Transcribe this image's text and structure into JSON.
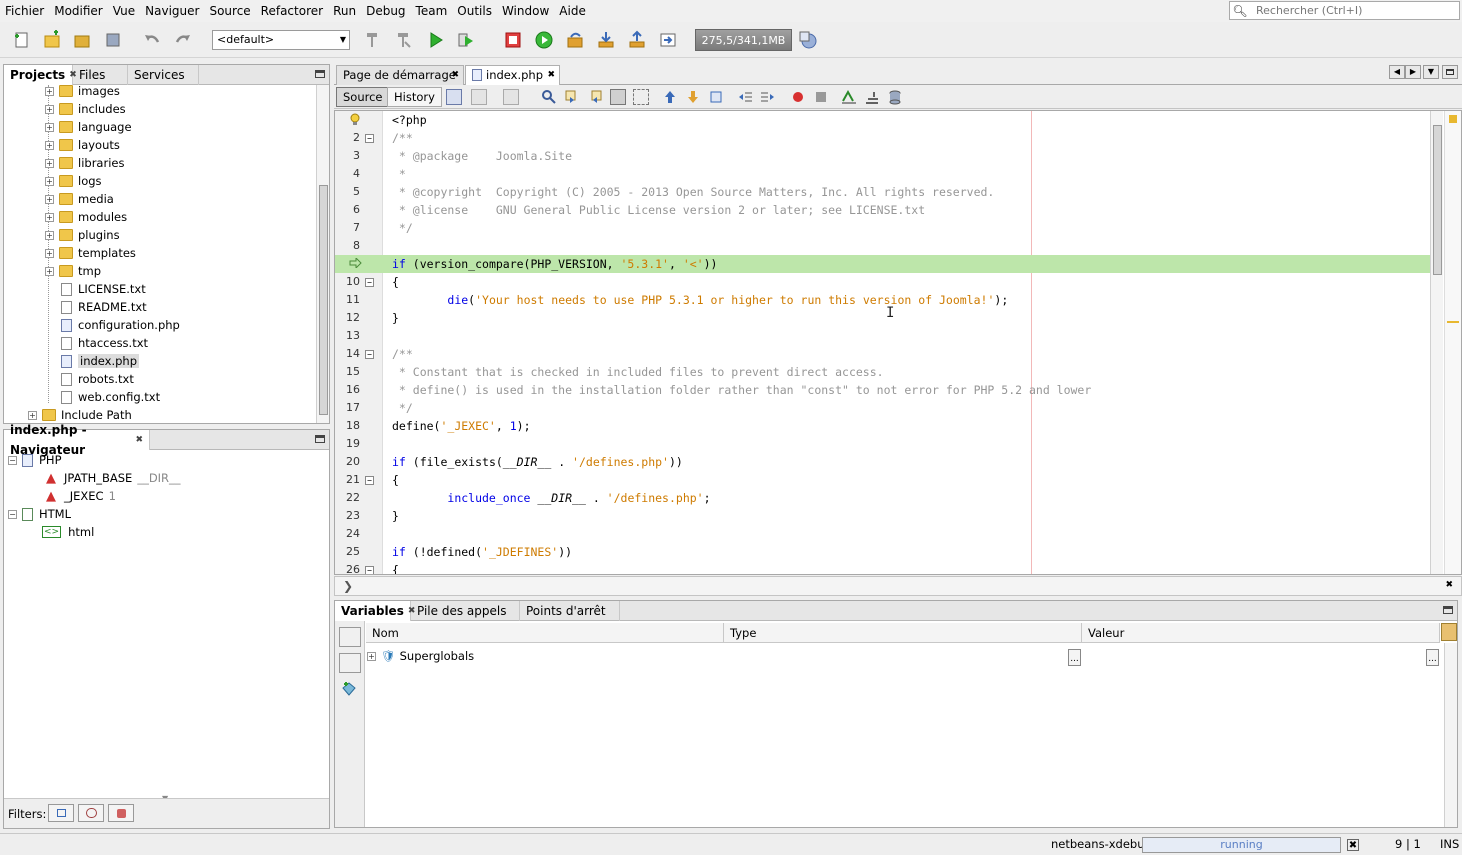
{
  "menubar": {
    "items": [
      "Fichier",
      "Modifier",
      "Vue",
      "Naviguer",
      "Source",
      "Refactorer",
      "Run",
      "Debug",
      "Team",
      "Outils",
      "Window",
      "Aide"
    ],
    "search_placeholder": "Rechercher (Ctrl+I)"
  },
  "toolbar": {
    "config_value": "<default>",
    "memory": "275,5/341,1MB"
  },
  "projects": {
    "tabs": [
      "Projects",
      "Files",
      "Services"
    ],
    "tree": [
      {
        "label": "images",
        "kind": "folder"
      },
      {
        "label": "includes",
        "kind": "folder"
      },
      {
        "label": "language",
        "kind": "folder"
      },
      {
        "label": "layouts",
        "kind": "folder"
      },
      {
        "label": "libraries",
        "kind": "folder"
      },
      {
        "label": "logs",
        "kind": "folder"
      },
      {
        "label": "media",
        "kind": "folder"
      },
      {
        "label": "modules",
        "kind": "folder"
      },
      {
        "label": "plugins",
        "kind": "folder"
      },
      {
        "label": "templates",
        "kind": "folder"
      },
      {
        "label": "tmp",
        "kind": "folder"
      },
      {
        "label": "LICENSE.txt",
        "kind": "file"
      },
      {
        "label": "README.txt",
        "kind": "file"
      },
      {
        "label": "configuration.php",
        "kind": "php"
      },
      {
        "label": "htaccess.txt",
        "kind": "file"
      },
      {
        "label": "index.php",
        "kind": "php"
      },
      {
        "label": "robots.txt",
        "kind": "file"
      },
      {
        "label": "web.config.txt",
        "kind": "file"
      }
    ],
    "include_path": "Include Path"
  },
  "navigator": {
    "title": "index.php - Navigateur",
    "php": "PHP",
    "jpath_base": "JPATH_BASE",
    "jpath_base_val": "__DIR__",
    "jexec": "_JEXEC",
    "jexec_val": "1",
    "html": "HTML",
    "html_child": "html",
    "filters": "Filters:"
  },
  "editor": {
    "tabs": [
      "Page de démarrage",
      "index.php"
    ],
    "source": "Source",
    "history": "History",
    "current_line": 9,
    "lines": [
      {
        "n": "",
        "segs": [
          [
            "t",
            "<?php"
          ]
        ]
      },
      {
        "n": "2",
        "fold": "−",
        "segs": [
          [
            "cm",
            "/**"
          ]
        ]
      },
      {
        "n": "3",
        "segs": [
          [
            "cm",
            " * @package    Joomla.Site"
          ]
        ]
      },
      {
        "n": "4",
        "segs": [
          [
            "cm",
            " *"
          ]
        ]
      },
      {
        "n": "5",
        "segs": [
          [
            "cm",
            " * @copyright  Copyright (C) 2005 - 2013 Open Source Matters, Inc. All rights reserved."
          ]
        ]
      },
      {
        "n": "6",
        "segs": [
          [
            "cm",
            " * @license    GNU General Public License version 2 or later; see LICENSE.txt"
          ]
        ]
      },
      {
        "n": "7",
        "segs": [
          [
            "cm",
            " */"
          ]
        ]
      },
      {
        "n": "8",
        "segs": []
      },
      {
        "n": "",
        "segs": [
          [
            "kw",
            "if"
          ],
          [
            "t",
            " (version_compare(PHP_VERSION, "
          ],
          [
            "str",
            "'5.3.1'"
          ],
          [
            "t",
            ", "
          ],
          [
            "str",
            "'<'"
          ],
          [
            "t",
            "))"
          ]
        ]
      },
      {
        "n": "10",
        "fold": "−",
        "segs": [
          [
            "t",
            "{"
          ]
        ]
      },
      {
        "n": "11",
        "segs": [
          [
            "t",
            "        "
          ],
          [
            "kw",
            "die"
          ],
          [
            "t",
            "("
          ],
          [
            "str",
            "'Your host needs to use PHP 5.3.1 or higher to run this version of Joomla!'"
          ],
          [
            "t",
            ");"
          ]
        ]
      },
      {
        "n": "12",
        "segs": [
          [
            "t",
            "}"
          ]
        ]
      },
      {
        "n": "13",
        "segs": []
      },
      {
        "n": "14",
        "fold": "−",
        "segs": [
          [
            "cm",
            "/**"
          ]
        ]
      },
      {
        "n": "15",
        "segs": [
          [
            "cm",
            " * Constant that is checked in included files to prevent direct access."
          ]
        ]
      },
      {
        "n": "16",
        "segs": [
          [
            "cm",
            " * define() is used in the installation folder rather than \"const\" to not error for PHP 5.2 and lower"
          ]
        ]
      },
      {
        "n": "17",
        "segs": [
          [
            "cm",
            " */"
          ]
        ]
      },
      {
        "n": "18",
        "segs": [
          [
            "t",
            "define("
          ],
          [
            "str",
            "'_JEXEC'"
          ],
          [
            "t",
            ", "
          ],
          [
            "num",
            "1"
          ],
          [
            "t",
            ");"
          ]
        ]
      },
      {
        "n": "19",
        "segs": []
      },
      {
        "n": "20",
        "segs": [
          [
            "kw",
            "if"
          ],
          [
            "t",
            " (file_exists("
          ],
          [
            "const",
            "__DIR__"
          ],
          [
            "t",
            " . "
          ],
          [
            "str",
            "'/defines.php'"
          ],
          [
            "t",
            "))"
          ]
        ]
      },
      {
        "n": "21",
        "fold": "−",
        "segs": [
          [
            "t",
            "{"
          ]
        ]
      },
      {
        "n": "22",
        "segs": [
          [
            "t",
            "        "
          ],
          [
            "kw",
            "include_once"
          ],
          [
            "t",
            " "
          ],
          [
            "const",
            "__DIR__"
          ],
          [
            "t",
            " . "
          ],
          [
            "str",
            "'/defines.php'"
          ],
          [
            "t",
            ";"
          ]
        ]
      },
      {
        "n": "23",
        "segs": [
          [
            "t",
            "}"
          ]
        ]
      },
      {
        "n": "24",
        "segs": []
      },
      {
        "n": "25",
        "segs": [
          [
            "kw",
            "if"
          ],
          [
            "t",
            " (!defined("
          ],
          [
            "str",
            "'_JDEFINES'"
          ],
          [
            "t",
            "))"
          ]
        ]
      },
      {
        "n": "26",
        "fold": "−",
        "segs": [
          [
            "t",
            "{"
          ]
        ]
      }
    ]
  },
  "variables": {
    "tabs": [
      "Variables",
      "Pile des appels",
      "Points d'arrêt"
    ],
    "columns": [
      "Nom",
      "Type",
      "Valeur"
    ],
    "rows": [
      {
        "name": "Superglobals",
        "type": "",
        "value": ""
      }
    ]
  },
  "status": {
    "session": "netbeans-xdebug",
    "state": "running",
    "position": "9 | 1",
    "mode": "INS"
  }
}
